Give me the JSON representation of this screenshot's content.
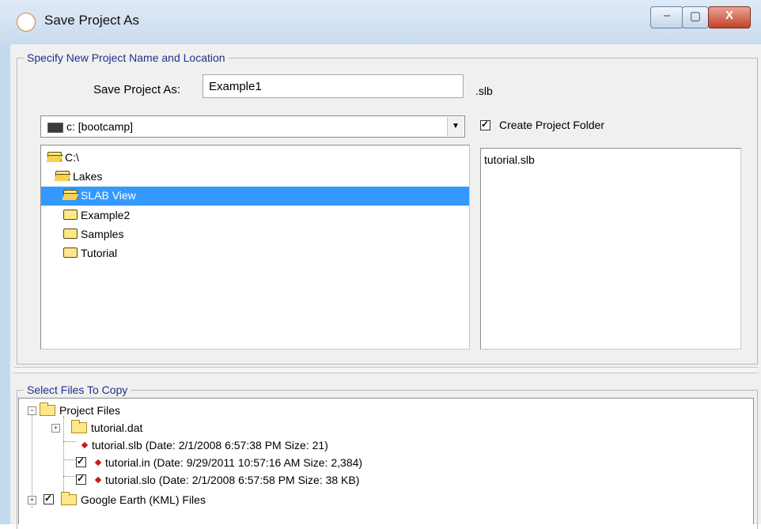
{
  "window": {
    "title": "Save Project As",
    "controls": {
      "minimize": "–",
      "maximize": "▢",
      "close": "X"
    }
  },
  "location_group": {
    "legend": "Specify New Project Name and Location",
    "save_as_label": "Save Project As:",
    "save_as_value": "Example1",
    "extension": ".slb",
    "drive": "c: [bootcamp]",
    "create_folder_label": "Create Project Folder",
    "create_folder_checked": true,
    "directories": [
      {
        "label": "C:\\",
        "icon": "open-folder-icon",
        "selected": false
      },
      {
        "label": "Lakes",
        "icon": "open-folder-icon",
        "selected": false
      },
      {
        "label": "SLAB View",
        "icon": "open-folder-icon",
        "selected": true
      },
      {
        "label": "Example2",
        "icon": "folder-icon",
        "selected": false
      },
      {
        "label": "Samples",
        "icon": "folder-icon",
        "selected": false
      },
      {
        "label": "Tutorial",
        "icon": "folder-icon",
        "selected": false
      }
    ],
    "files": [
      "tutorial.slb"
    ]
  },
  "copy_group": {
    "legend": "Select Files To Copy",
    "tree": [
      {
        "label": "Project Files",
        "expander": "−",
        "checkbox": false
      },
      {
        "label": "tutorial.dat",
        "expander": "+",
        "checkbox": false
      },
      {
        "label": "tutorial.slb (Date: 2/1/2008 6:57:38 PM  Size: 21)",
        "checkbox": false
      },
      {
        "label": "tutorial.in (Date: 9/29/2011 10:57:16 AM  Size: 2,384)",
        "checkbox": true
      },
      {
        "label": "tutorial.slo (Date: 2/1/2008 6:57:58 PM  Size: 38 KB)",
        "checkbox": true
      },
      {
        "label": "Google Earth (KML) Files",
        "expander": "+",
        "checkbox": true
      }
    ]
  }
}
